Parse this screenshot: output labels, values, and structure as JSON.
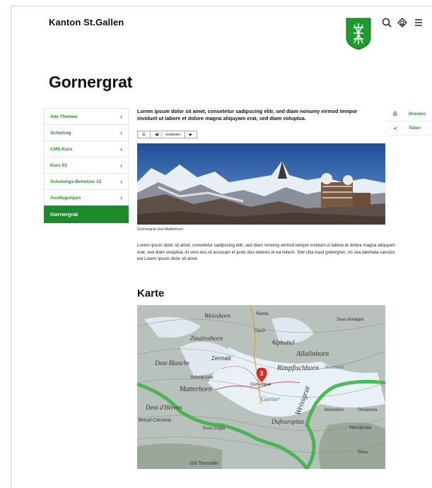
{
  "header": {
    "brand": "Kanton St.Gallen",
    "icons": [
      "search-icon",
      "language-icon",
      "menu-icon"
    ]
  },
  "page": {
    "title": "Gornergrat"
  },
  "sidebar": {
    "items": [
      {
        "label": "Alle Themen"
      },
      {
        "label": "Schulung"
      },
      {
        "label": "CMS-Kurs"
      },
      {
        "label": "Kurs 53"
      },
      {
        "label": "Schulungs-Benutzer 12"
      },
      {
        "label": "Ausflugstipps"
      },
      {
        "label": "Gornergrat"
      }
    ]
  },
  "content": {
    "intro_line1": "Lorem ipsum dolor sit amet, consetetur sadipscing elitr, sed diam nonumy eirmod tempor",
    "intro_line2": "invidunt ut labore et dolore magna aliquyam erat, sed diam voluptua.",
    "reader_label": "vorlesen",
    "image_caption": "Gornergrat und Matterhorn",
    "body": "Lorem ipsum dolor sit amet, consetetur sadipscing elitr, sed diam nonumy eirmod tempor invidunt ut labore et dolore magna aliquyam erat, sed diam voluptua. At vero eos et accusam et justo duo dolores et ea rebum. Stet clita kasd gubergren, no sea takimata sanctus est Lorem ipsum dolor sit amet.",
    "map_heading": "Karte"
  },
  "actions": {
    "print_label": "Drucken",
    "share_label": "Teilen"
  },
  "map": {
    "marker_number": "3",
    "labels": {
      "weisshorn": "Weisshorn",
      "zinalrothorn": "Zinalrothorn",
      "dent_blanche": "Dent Blanche",
      "zermatt": "Zermatt",
      "matterhorn": "Matterhorn",
      "dent_herens": "Dent d'Hérens",
      "breuil": "Breuil-Cervinia",
      "alphubel": "Alphubel",
      "allalinhorn": "Allalinhorn",
      "rimpfischhorn": "Rimpfischhorn",
      "weissgrat": "Weissgrat",
      "gorner": "Gorner",
      "dufourspitze": "Dufourspitze",
      "saas_almagell": "Saas Almagell",
      "randa": "Randa",
      "tasch": "Täsch",
      "schwarzsee": "Schwarzsee",
      "gornergrat": "Gornergrat",
      "mattmark": "Mattmark",
      "belvedere": "Belvedere",
      "macugnaga": "Macugnaga",
      "pestarena": "Pestarena",
      "rima": "Rima",
      "gd_tournalin": "Gd-Tournalin",
      "testa_grigia": "Testa Grigia"
    }
  },
  "colors": {
    "accent": "#1e8a2e",
    "link": "#2a8a2a"
  }
}
